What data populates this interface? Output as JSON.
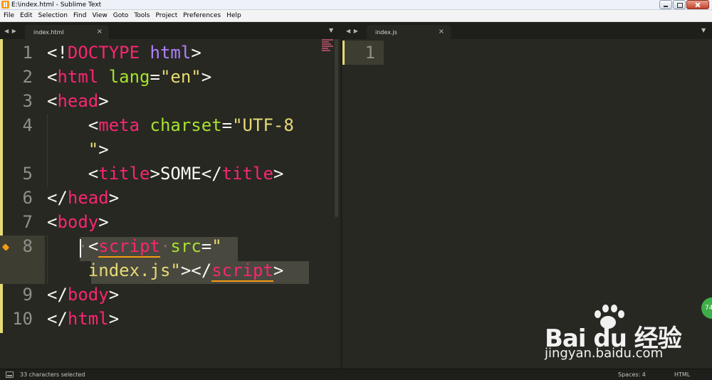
{
  "window": {
    "title": "E:\\index.html - Sublime Text"
  },
  "menu": [
    "File",
    "Edit",
    "Selection",
    "Find",
    "View",
    "Goto",
    "Tools",
    "Project",
    "Preferences",
    "Help"
  ],
  "tabs": {
    "left": {
      "label": "index.html",
      "close": "×",
      "arrows": "◀ ▶",
      "dropdown": "▼"
    },
    "right": {
      "label": "index.js",
      "close": "×",
      "arrows": "◀ ▶",
      "dropdown": "▼"
    }
  },
  "editor_left": {
    "line_numbers": [
      "1",
      "2",
      "3",
      "4",
      "",
      "5",
      "6",
      "7",
      "8",
      "",
      "9",
      "10"
    ],
    "lines": [
      [
        {
          "t": "<!",
          "c": ""
        },
        {
          "t": "DOCTYPE",
          "c": "tag"
        },
        {
          "t": " ",
          "c": ""
        },
        {
          "t": "html",
          "c": "attr-purple"
        },
        {
          "t": ">",
          "c": ""
        }
      ],
      [
        {
          "t": "<",
          "c": ""
        },
        {
          "t": "html",
          "c": "tag"
        },
        {
          "t": " ",
          "c": ""
        },
        {
          "t": "lang",
          "c": "attr"
        },
        {
          "t": "=",
          "c": ""
        },
        {
          "t": "\"en\"",
          "c": "str"
        },
        {
          "t": ">",
          "c": ""
        }
      ],
      [
        {
          "t": "<",
          "c": ""
        },
        {
          "t": "head",
          "c": "tag"
        },
        {
          "t": ">",
          "c": ""
        }
      ],
      [
        {
          "t": "    <",
          "c": ""
        },
        {
          "t": "meta",
          "c": "tag"
        },
        {
          "t": " ",
          "c": ""
        },
        {
          "t": "charset",
          "c": "attr"
        },
        {
          "t": "=",
          "c": ""
        },
        {
          "t": "\"UTF-8",
          "c": "str"
        }
      ],
      [
        {
          "t": "    ",
          "c": ""
        },
        {
          "t": "\"",
          "c": "str"
        },
        {
          "t": ">",
          "c": ""
        }
      ],
      [
        {
          "t": "    <",
          "c": ""
        },
        {
          "t": "title",
          "c": "tag"
        },
        {
          "t": ">SOME</",
          "c": ""
        },
        {
          "t": "title",
          "c": "tag"
        },
        {
          "t": ">",
          "c": ""
        }
      ],
      [
        {
          "t": "</",
          "c": ""
        },
        {
          "t": "head",
          "c": "tag"
        },
        {
          "t": ">",
          "c": ""
        }
      ],
      [
        {
          "t": "<",
          "c": ""
        },
        {
          "t": "body",
          "c": "tag"
        },
        {
          "t": ">",
          "c": ""
        }
      ],
      [
        {
          "t": "   ",
          "c": ""
        },
        {
          "t": "·",
          "c": "dot"
        },
        {
          "t": "<",
          "c": ""
        },
        {
          "t": "script",
          "c": "tag ul"
        },
        {
          "t": "·",
          "c": "dot"
        },
        {
          "t": "src",
          "c": "attr"
        },
        {
          "t": "=",
          "c": ""
        },
        {
          "t": "\"",
          "c": "str"
        }
      ],
      [
        {
          "t": "    ",
          "c": ""
        },
        {
          "t": "index.js\"",
          "c": "str"
        },
        {
          "t": "></",
          "c": ""
        },
        {
          "t": "script",
          "c": "tag ul"
        },
        {
          "t": ">",
          "c": ""
        }
      ],
      [
        {
          "t": "</",
          "c": ""
        },
        {
          "t": "body",
          "c": "tag"
        },
        {
          "t": ">",
          "c": ""
        }
      ],
      [
        {
          "t": "</",
          "c": ""
        },
        {
          "t": "html",
          "c": "tag"
        },
        {
          "t": ">",
          "c": ""
        }
      ]
    ]
  },
  "editor_right": {
    "line_numbers": [
      "1"
    ]
  },
  "status": {
    "selection": "33 characters selected",
    "indent": "Spaces: 4",
    "syntax": "HTML"
  },
  "watermark": {
    "logo": "Bai du 经验",
    "url": "jingyan.baidu.com",
    "badge": "74"
  },
  "colors": {
    "background": "#272822",
    "tag": "#f92672",
    "attribute": "#a6e22e",
    "string": "#e6db74",
    "text": "#f8f8f2",
    "gutter": "#908f88"
  }
}
